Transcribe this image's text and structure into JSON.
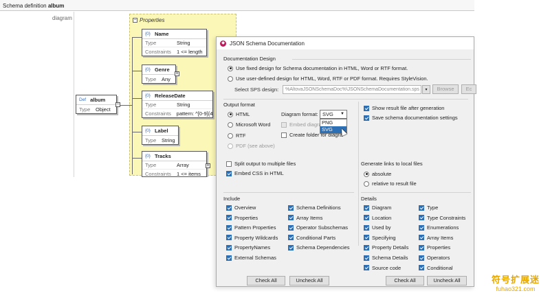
{
  "schema_view": {
    "header_prefix": "Schema definition",
    "header_name": "album",
    "diagram_label": "diagram",
    "properties_label": "Properties",
    "root": {
      "badge": "Def",
      "name": "album",
      "type_key": "Type",
      "type_val": "Object"
    },
    "nodes": [
      {
        "name": "Name",
        "type_key": "Type",
        "type_val": "String",
        "c_key": "Constraints",
        "c_val": "1 <= length"
      },
      {
        "name": "Genre",
        "type_key": "Type",
        "type_val": "Any"
      },
      {
        "name": "ReleaseDate",
        "type_key": "Type",
        "type_val": "String",
        "c_key": "Constraints",
        "c_val": "pattern: ^[0-9]{4"
      },
      {
        "name": "Label",
        "type_key": "Type",
        "type_val": "String"
      },
      {
        "name": "Tracks",
        "type_key": "Type",
        "type_val": "Array",
        "c_key": "Constraints",
        "c_val": "1 <= items"
      }
    ],
    "pin_badge": "{0}"
  },
  "dialog": {
    "title": "JSON Schema Documentation",
    "design": {
      "title": "Documentation Design",
      "opt_fixed": "Use fixed design for Schema documentation in HTML, Word or RTF format.",
      "opt_user": "Use user-defined design for HTML, Word, RTF or PDF format. Requires StyleVision.",
      "sps_label": "Select SPS design:",
      "sps_value": "%AltovaJSONSchemaDoc%\\JSONSchemaDocumentation.sps",
      "browse": "Browse",
      "edit": "Ec"
    },
    "output": {
      "title": "Output format",
      "html": "HTML",
      "word": "Microsoft Word",
      "rtf": "RTF",
      "pdf": "PDF (see above)",
      "diagram_format_label": "Diagram format:",
      "diagram_format_value": "SVG",
      "diagram_options": [
        "PNG",
        "SVG"
      ],
      "embed_diagrams": "Embed diagrams",
      "create_folder": "Create folder for diagrams",
      "show_result": "Show result file after generation",
      "save_settings": "Save schema documentation settings",
      "split_output": "Split output to multiple files",
      "embed_css": "Embed CSS in HTML"
    },
    "links": {
      "title": "Generate links to local files",
      "absolute": "absolute",
      "relative": "relative to result file"
    },
    "include": {
      "title": "Include",
      "col1": [
        "Overview",
        "Properties",
        "Pattern Properties",
        "Property Wildcards",
        "PropertyNames",
        "External Schemas"
      ],
      "col2": [
        "Schema Definitions",
        "Array Items",
        "Operator Subschemas",
        "Conditional Parts",
        "Schema Dependencies"
      ],
      "check_all": "Check All",
      "uncheck_all": "Uncheck All"
    },
    "details": {
      "title": "Details",
      "col1": [
        "Diagram",
        "Location",
        "Used by",
        "Specifying",
        "Property Details",
        "Schema Details",
        "Source code"
      ],
      "col2": [
        "Type",
        "Type Constraints",
        "Enumerations",
        "Array Items",
        "Properties",
        "Operators",
        "Conditional"
      ],
      "check_all": "Check All",
      "uncheck_all": "Uncheck All"
    }
  },
  "watermark": {
    "top": "符号扩展迷",
    "bottom": "fuhao321.com"
  },
  "colors": {
    "accent": "#2d6fb5",
    "props_bg": "#fbf7b6",
    "watermark": "#e5a700"
  }
}
